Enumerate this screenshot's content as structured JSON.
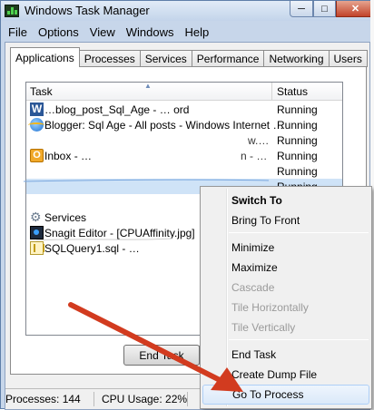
{
  "window": {
    "title": "Windows Task Manager"
  },
  "menu": [
    "File",
    "Options",
    "View",
    "Windows",
    "Help"
  ],
  "tabs": [
    "Applications",
    "Processes",
    "Services",
    "Performance",
    "Networking",
    "Users"
  ],
  "active_tab": "Applications",
  "list": {
    "headers": {
      "task": "Task",
      "status": "Status"
    },
    "rows": [
      {
        "icon": "word-icon",
        "name": "…blog_post_Sql_Age - … ord",
        "name2": "",
        "status": "Running"
      },
      {
        "icon": "internet-explorer-icon",
        "name": "Blogger: Sql Age - All posts - Windows Internet …",
        "name2": "",
        "status": "Running"
      },
      {
        "icon": "",
        "name": "",
        "name2": "w.…",
        "status": "Running"
      },
      {
        "icon": "outlook-icon",
        "name": "Inbox - …",
        "name2": "n - …",
        "status": "Running"
      },
      {
        "icon": "",
        "name": "",
        "name2": "",
        "status": "Running"
      },
      {
        "icon": "",
        "name": "",
        "name2": "",
        "status": "Running"
      },
      {
        "icon": "",
        "name": "",
        "name2": "",
        "status": ""
      },
      {
        "icon": "services-icon",
        "name": "Services",
        "name2": "",
        "status": ""
      },
      {
        "icon": "snagit-icon",
        "name": "Snagit Editor - [CPUAffinity.jpg]",
        "name2": "",
        "status": ""
      },
      {
        "icon": "sql-query-icon",
        "name": "SQLQuery1.sql - …",
        "name2": "",
        "status": ""
      }
    ]
  },
  "buttons": {
    "end_task": "End Task"
  },
  "statusbar": {
    "processes": "Processes: 144",
    "cpu": "CPU Usage: 22%"
  },
  "context_menu": {
    "items": [
      {
        "label": "Switch To",
        "style": "bold"
      },
      {
        "label": "Bring To Front",
        "style": "normal"
      },
      {
        "label": "Minimize",
        "style": "normal"
      },
      {
        "label": "Maximize",
        "style": "normal"
      },
      {
        "label": "Cascade",
        "style": "disabled"
      },
      {
        "label": "Tile Horizontally",
        "style": "disabled"
      },
      {
        "label": "Tile Vertically",
        "style": "disabled"
      },
      {
        "label": "End Task",
        "style": "normal"
      },
      {
        "label": "Create Dump File",
        "style": "normal"
      },
      {
        "label": "Go To Process",
        "style": "highlighted"
      }
    ]
  },
  "annotation": {
    "arrow_color": "#d23b1f"
  }
}
